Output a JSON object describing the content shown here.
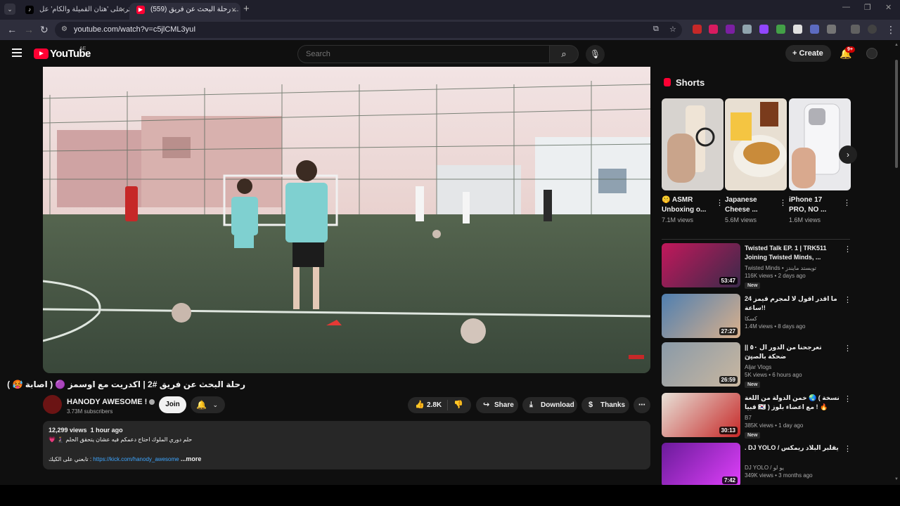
{
  "browser": {
    "tabs": [
      {
        "title": "اعثر على 'هتان القميلة والكام' عل...",
        "active": false
      },
      {
        "title": "(559) رحلة البحث عن فريق ...",
        "active": true
      }
    ],
    "url": "youtube.com/watch?v=c5jlCML3yuI"
  },
  "header": {
    "logo_text": "YouTube",
    "region": "AE",
    "search_placeholder": "Search",
    "create_label": "Create",
    "notifications": "9+"
  },
  "video": {
    "title": "رحلة البحث عن فريق #2 | اكدريت مع اوسمز 🟣 ( اصابة 🥵 )",
    "channel": "HANODY AWESOME !",
    "subscribers": "3.73M subscribers",
    "join_label": "Join",
    "likes": "2.8K",
    "share_label": "Share",
    "download_label": "Download",
    "thanks_label": "Thanks",
    "views": "12,299 views",
    "age": "1 hour ago",
    "desc_line1": "💗 🧎‍♀️ حلم دوري الملوك احتاج دعمكم فيه عشان يتحقق الحلم",
    "desc_line2_prefix": "تابعني على الكيك :",
    "desc_link": "https://kick.com/hanody_awesome",
    "desc_more": "...more"
  },
  "shorts": {
    "heading": "Shorts",
    "items": [
      {
        "title": "🤫 ASMR Unboxing o...",
        "views": "7.1M views"
      },
      {
        "title": "Japanese Cheese ...",
        "views": "5.6M views"
      },
      {
        "title": "iPhone 17 PRO, NO ...",
        "views": "1.6M views"
      }
    ]
  },
  "recommended": [
    {
      "title": "Twisted Talk EP. 1 | TRK511 Joining Twisted Minds, ...",
      "channel": "Twisted Minds • تويستد مايندز",
      "stats": "116K views • 2 days ago",
      "badge": "New",
      "duration": "53:47",
      "colors": [
        "#c2185b",
        "#3a2a4a"
      ]
    },
    {
      "title": "ما اقدر اقول لا لمجرم قيمز 24 ساعة!!",
      "channel": "كسكا",
      "stats": "1.4M views • 8 days ago",
      "badge": "",
      "duration": "27:27",
      "colors": [
        "#4f7fb0",
        "#d9b08c"
      ]
    },
    {
      "title": "تعرجحنا من الدور ال ٥٠ || ضحكة بالصين",
      "channel": "CN\nAljar Vlogs",
      "stats": "5K views • 6 hours ago",
      "badge": "New",
      "duration": "26:59",
      "colors": [
        "#8a9aa8",
        "#c9b7a0"
      ]
    },
    {
      "title": "خمن الدولة من اللغة 🌏 ( نسخة قبيا 🇰🇷 ) مع اعضاء بلوز ! 🔥",
      "channel": "B7",
      "stats": "385K views • 1 day ago",
      "badge": "New",
      "duration": "30:13",
      "colors": [
        "#e8e2d8",
        "#c62828"
      ]
    },
    {
      "title": ". DJ YOLO / يقلبر البلاد ريمكس",
      "channel": "DJ YOLO / يو لو",
      "stats": "349K views • 3 months ago",
      "badge": "",
      "duration": "7:42",
      "colors": [
        "#6a1b9a",
        "#e040fb"
      ]
    }
  ]
}
